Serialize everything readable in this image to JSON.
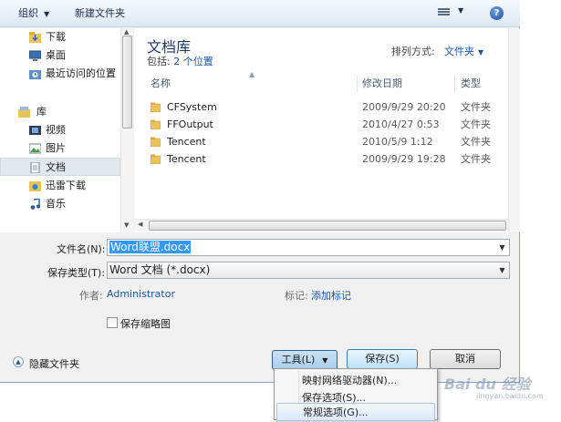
{
  "toolbar": {
    "organize_label": "组织",
    "new_folder_label": "新建文件夹",
    "help_glyph": "?"
  },
  "nav": {
    "items": [
      {
        "label": "下载",
        "icon": "download-folder-icon"
      },
      {
        "label": "桌面",
        "icon": "desktop-icon"
      },
      {
        "label": "最近访问的位置",
        "icon": "recent-places-icon"
      },
      {
        "label": "库",
        "icon": "library-icon"
      },
      {
        "label": "视频",
        "icon": "video-icon"
      },
      {
        "label": "图片",
        "icon": "picture-icon"
      },
      {
        "label": "文档",
        "icon": "document-icon",
        "selected": true
      },
      {
        "label": "迅雷下载",
        "icon": "thunder-download-icon"
      },
      {
        "label": "音乐",
        "icon": "music-icon"
      }
    ]
  },
  "library": {
    "title": "文档库",
    "includes_label": "包括:",
    "includes_link": "2 个位置",
    "arrange_label": "排列方式:",
    "arrange_value": "文件夹"
  },
  "columns": {
    "name": "名称",
    "date": "修改日期",
    "type": "类型"
  },
  "files": [
    {
      "name": "CFSystem",
      "date": "2009/9/29 20:20",
      "type": "文件夹"
    },
    {
      "name": "FFOutput",
      "date": "2010/4/27 0:53",
      "type": "文件夹"
    },
    {
      "name": "Tencent",
      "date": "2010/5/9 1:12",
      "type": "文件夹"
    },
    {
      "name": "Tencent",
      "date": "2009/9/29 19:28",
      "type": "文件夹"
    }
  ],
  "form": {
    "filename_label": "文件名(N):",
    "filename_value": "Word联盟.docx",
    "savetype_label": "保存类型(T):",
    "savetype_value": "Word 文档 (*.docx)",
    "author_label": "作者:",
    "author_value": "Administrator",
    "tags_label": "标记:",
    "tags_value": "添加标记",
    "thumbnail_label": "保存缩略图"
  },
  "footer": {
    "hide_folders_label": "隐藏文件夹",
    "tools_label": "工具(L)",
    "save_label": "保存(S)",
    "cancel_label": "取消"
  },
  "tools_menu": {
    "items": [
      {
        "label": "映射网络驱动器(N)..."
      },
      {
        "label": "保存选项(S)..."
      },
      {
        "label": "常规选项(G)...",
        "highlighted": true
      }
    ]
  },
  "watermark": {
    "text": "Bai du 经验",
    "sub": "jingyan.baidu.com"
  },
  "colors": {
    "accent_blue": "#1a56a8",
    "title_blue": "#1e395b",
    "selection_blue": "#3399ff",
    "dialog_bg": "#f0f0f0"
  }
}
